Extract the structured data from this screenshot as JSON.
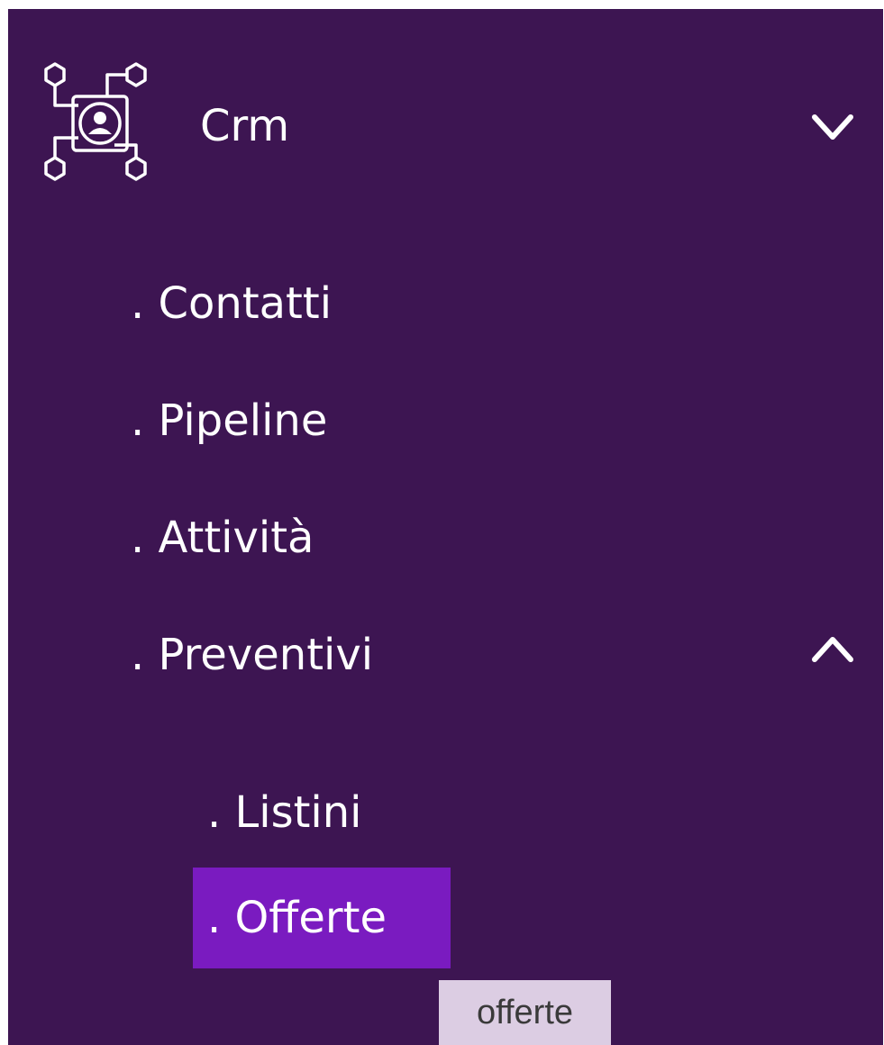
{
  "sidebar": {
    "background_color": "#3d1552",
    "active_color": "#7a1bc0",
    "section": {
      "label": "Crm",
      "icon": "crm-network-icon",
      "expand_icon": "chevron-down-icon"
    },
    "items": [
      {
        "label": ". Contatti"
      },
      {
        "label": ". Pipeline"
      },
      {
        "label": ". Attività"
      },
      {
        "label": ". Preventivi",
        "expand_icon": "chevron-up-icon"
      }
    ],
    "subitems": [
      {
        "label": ". Listini"
      },
      {
        "label": ". Offerte",
        "active": true
      }
    ]
  },
  "tooltip": {
    "text": "offerte"
  }
}
